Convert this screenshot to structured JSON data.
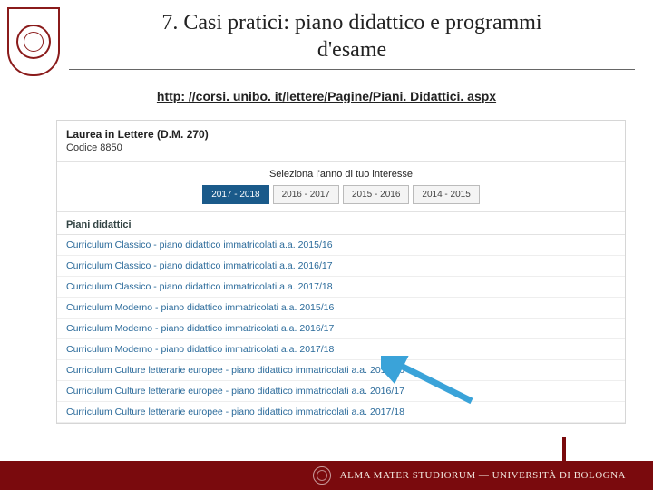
{
  "slide": {
    "title_line1": "7. Casi pratici: piano didattico e programmi",
    "title_line2": "d'esame",
    "url": "http: //corsi. unibo. it/lettere/Pagine/Piani. Didattici. aspx"
  },
  "screenshot": {
    "degree_title": "Laurea in Lettere (D.M. 270)",
    "degree_code": "Codice 8850",
    "select_year_label": "Seleziona l'anno di tuo interesse",
    "years": [
      "2017 - 2018",
      "2016 - 2017",
      "2015 - 2016",
      "2014 - 2015"
    ],
    "active_year_index": 0,
    "piani_heading": "Piani didattici",
    "plans": [
      "Curriculum Classico - piano didattico immatricolati a.a. 2015/16",
      "Curriculum Classico - piano didattico immatricolati a.a. 2016/17",
      "Curriculum Classico - piano didattico immatricolati a.a. 2017/18",
      "Curriculum Moderno - piano didattico immatricolati a.a. 2015/16",
      "Curriculum Moderno - piano didattico immatricolati a.a. 2016/17",
      "Curriculum Moderno - piano didattico immatricolati a.a. 2017/18",
      "Curriculum Culture letterarie europee - piano didattico immatricolati a.a. 2015/16",
      "Curriculum Culture letterarie europee - piano didattico immatricolati a.a. 2016/17",
      "Curriculum Culture letterarie europee - piano didattico immatricolati a.a. 2017/18"
    ]
  },
  "footer": {
    "text": "ALMA MATER STUDIORUM ― UNIVERSITÀ DI BOLOGNA"
  }
}
